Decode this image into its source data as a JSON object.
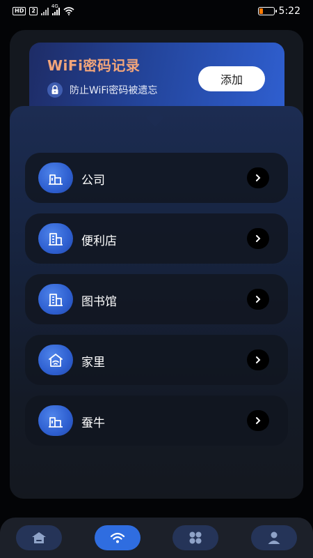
{
  "status_bar": {
    "network_badge": "HD",
    "sim_badge": "2",
    "signal_label": "4G",
    "time": "5:22",
    "battery_color": "#ff7a00"
  },
  "banner": {
    "title": "WiFi密码记录",
    "subtitle": "防止WiFi密码被遗忘",
    "add_label": "添加",
    "lock_icon": "lock-icon"
  },
  "list": {
    "items": [
      {
        "label": "公司",
        "icon": "office-building-icon"
      },
      {
        "label": "便利店",
        "icon": "store-building-icon"
      },
      {
        "label": "图书馆",
        "icon": "library-building-icon"
      },
      {
        "label": "家里",
        "icon": "home-icon"
      },
      {
        "label": "蚕牛",
        "icon": "office-building-icon"
      }
    ]
  },
  "bottom_nav": {
    "items": [
      {
        "name": "home",
        "icon": "home-icon",
        "active": false
      },
      {
        "name": "wifi",
        "icon": "wifi-icon",
        "active": true
      },
      {
        "name": "apps",
        "icon": "apps-grid-icon",
        "active": false
      },
      {
        "name": "profile",
        "icon": "user-icon",
        "active": false
      }
    ]
  },
  "colors": {
    "accent": "#2f6de0",
    "title_accent": "#f2a57a",
    "background": "#030406",
    "card": "#14181f"
  }
}
